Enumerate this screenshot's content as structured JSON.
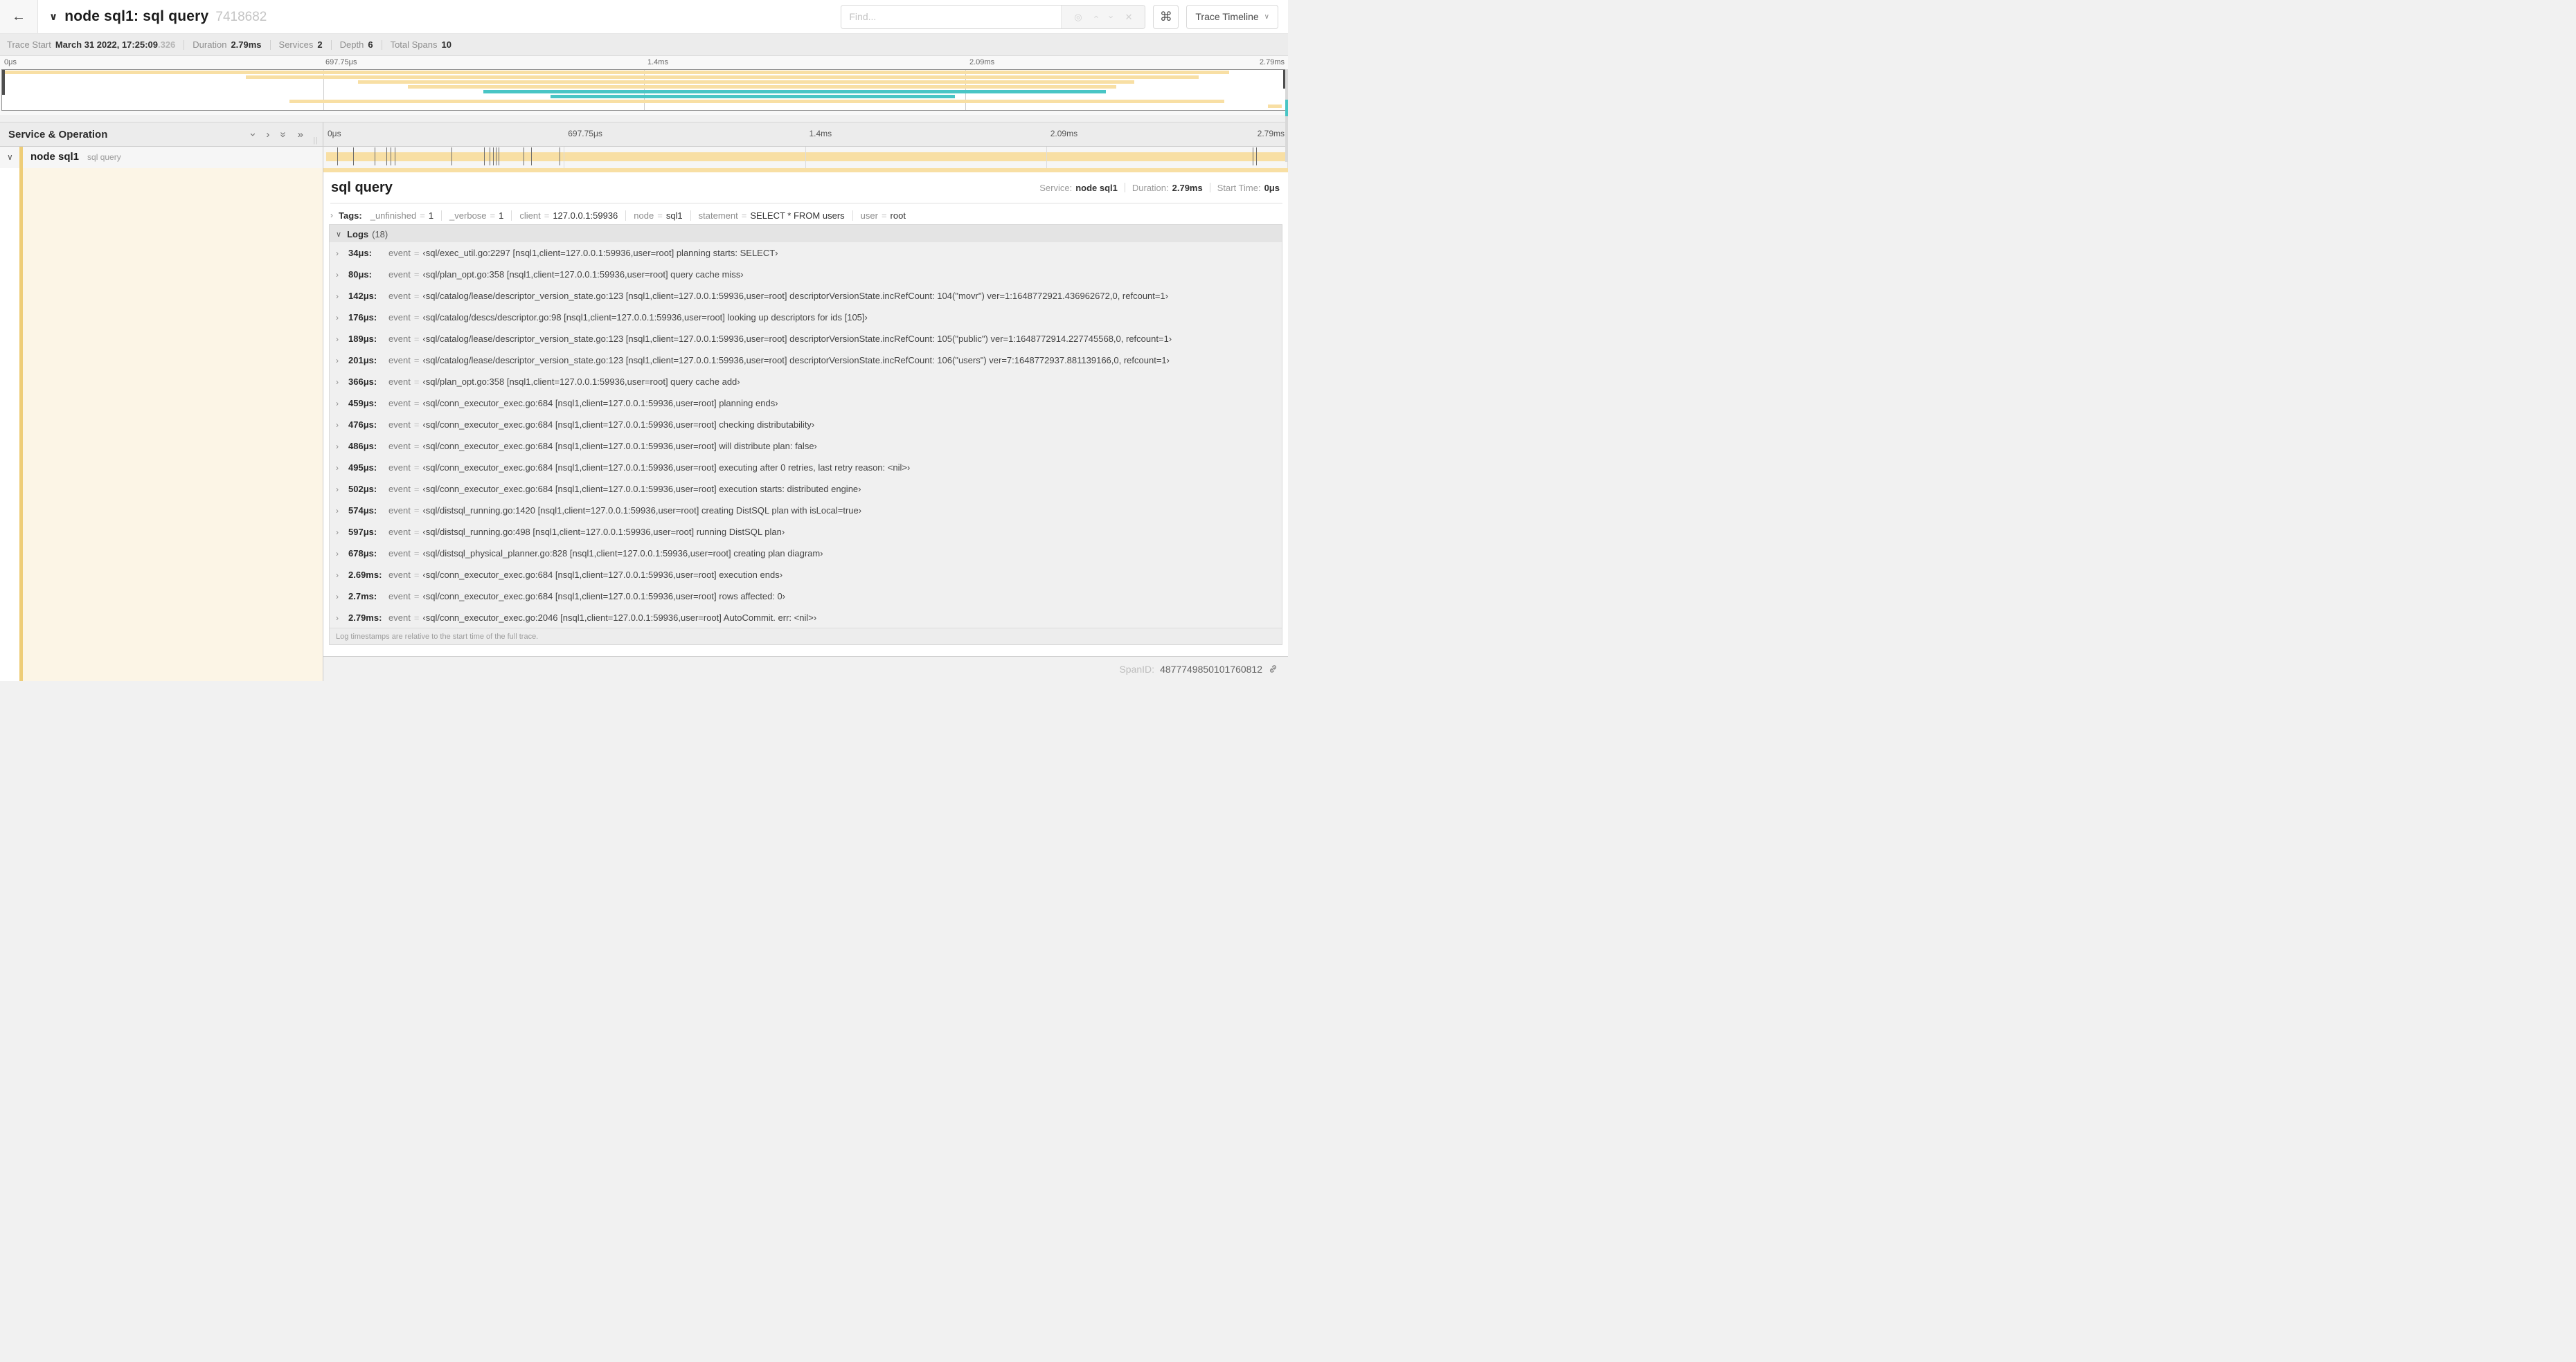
{
  "icons": {
    "back": "←",
    "title_chevron": "∨",
    "command": "⌘",
    "caret_down": "∨",
    "locate": "◎",
    "prev_match": "›",
    "next_match": "›",
    "clear": "✕",
    "collapse_one": "›",
    "expand_one": "›",
    "collapse_all": "»",
    "expand_all": "»",
    "resizer": "||",
    "row_chevron": "∨",
    "item_chevron": "›"
  },
  "header": {
    "title": "node sql1: sql query",
    "trace_id": "7418682",
    "find_placeholder": "Find...",
    "view_select_label": "Trace Timeline"
  },
  "info_bar": {
    "items": [
      {
        "label": "Trace Start",
        "value": "March 31 2022, 17:25:09",
        "suffix": ".326"
      },
      {
        "label": "Duration",
        "value": "2.79ms"
      },
      {
        "label": "Services",
        "value": "2"
      },
      {
        "label": "Depth",
        "value": "6"
      },
      {
        "label": "Total Spans",
        "value": "10"
      }
    ]
  },
  "left_header": {
    "title": "Service & Operation"
  },
  "span_row": {
    "service": "node sql1",
    "operation": "sql query"
  },
  "timeline": {
    "ruler_ticks": [
      "0μs",
      "697.75μs",
      "1.4ms",
      "2.09ms",
      "2.79ms"
    ],
    "total_us": 2790,
    "log_marks_us": [
      34,
      80,
      142,
      176,
      189,
      201,
      366,
      459,
      476,
      486,
      495,
      502,
      574,
      597,
      678,
      2690,
      2700,
      2790
    ],
    "minimap_spans": [
      {
        "row": 0,
        "start": 0.0,
        "end": 0.956,
        "color": "tan"
      },
      {
        "row": 1,
        "start": 0.19,
        "end": 0.932,
        "color": "tan"
      },
      {
        "row": 2,
        "start": 0.277,
        "end": 0.882,
        "color": "tan"
      },
      {
        "row": 3,
        "start": 0.316,
        "end": 0.868,
        "color": "tan"
      },
      {
        "row": 4,
        "start": 0.375,
        "end": 0.86,
        "color": "teal"
      },
      {
        "row": 5,
        "start": 0.427,
        "end": 0.742,
        "color": "teal"
      },
      {
        "row": 6,
        "start": 0.224,
        "end": 0.952,
        "color": "tan"
      },
      {
        "row": 7,
        "start": 0.986,
        "end": 0.997,
        "color": "tan"
      }
    ]
  },
  "colors": {
    "tan": "#f8dfa4",
    "teal": "#49c5c5",
    "accent": "#eecd78",
    "cream": "#fcf5e6"
  },
  "detail": {
    "title": "sql query",
    "meta": [
      {
        "label": "Service:",
        "value": "node sql1"
      },
      {
        "label": "Duration:",
        "value": "2.79ms"
      },
      {
        "label": "Start Time:",
        "value": "0μs"
      }
    ],
    "tags_label": "Tags:",
    "kv_separator": "=",
    "tags": [
      {
        "key": "_unfinished",
        "value": "1"
      },
      {
        "key": "_verbose",
        "value": "1"
      },
      {
        "key": "client",
        "value": "127.0.0.1:59936"
      },
      {
        "key": "node",
        "value": "sql1"
      },
      {
        "key": "statement",
        "value": "SELECT * FROM users"
      },
      {
        "key": "user",
        "value": "root"
      }
    ],
    "logs_label": "Logs",
    "logs_count": "(18)",
    "log_key": "event",
    "logs": [
      {
        "time": "34μs:",
        "value": "‹sql/exec_util.go:2297 [nsql1,client=127.0.0.1:59936,user=root] planning starts: SELECT›"
      },
      {
        "time": "80μs:",
        "value": "‹sql/plan_opt.go:358 [nsql1,client=127.0.0.1:59936,user=root] query cache miss›"
      },
      {
        "time": "142μs:",
        "value": "‹sql/catalog/lease/descriptor_version_state.go:123 [nsql1,client=127.0.0.1:59936,user=root] descriptorVersionState.incRefCount: 104(\"movr\") ver=1:1648772921.436962672,0, refcount=1›"
      },
      {
        "time": "176μs:",
        "value": "‹sql/catalog/descs/descriptor.go:98 [nsql1,client=127.0.0.1:59936,user=root] looking up descriptors for ids [105]›"
      },
      {
        "time": "189μs:",
        "value": "‹sql/catalog/lease/descriptor_version_state.go:123 [nsql1,client=127.0.0.1:59936,user=root] descriptorVersionState.incRefCount: 105(\"public\") ver=1:1648772914.227745568,0, refcount=1›"
      },
      {
        "time": "201μs:",
        "value": "‹sql/catalog/lease/descriptor_version_state.go:123 [nsql1,client=127.0.0.1:59936,user=root] descriptorVersionState.incRefCount: 106(\"users\") ver=7:1648772937.881139166,0, refcount=1›"
      },
      {
        "time": "366μs:",
        "value": "‹sql/plan_opt.go:358 [nsql1,client=127.0.0.1:59936,user=root] query cache add›"
      },
      {
        "time": "459μs:",
        "value": "‹sql/conn_executor_exec.go:684 [nsql1,client=127.0.0.1:59936,user=root] planning ends›"
      },
      {
        "time": "476μs:",
        "value": "‹sql/conn_executor_exec.go:684 [nsql1,client=127.0.0.1:59936,user=root] checking distributability›"
      },
      {
        "time": "486μs:",
        "value": "‹sql/conn_executor_exec.go:684 [nsql1,client=127.0.0.1:59936,user=root] will distribute plan: false›"
      },
      {
        "time": "495μs:",
        "value": "‹sql/conn_executor_exec.go:684 [nsql1,client=127.0.0.1:59936,user=root] executing after 0 retries, last retry reason: <nil>›"
      },
      {
        "time": "502μs:",
        "value": "‹sql/conn_executor_exec.go:684 [nsql1,client=127.0.0.1:59936,user=root] execution starts: distributed engine›"
      },
      {
        "time": "574μs:",
        "value": "‹sql/distsql_running.go:1420 [nsql1,client=127.0.0.1:59936,user=root] creating DistSQL plan with isLocal=true›"
      },
      {
        "time": "597μs:",
        "value": "‹sql/distsql_running.go:498 [nsql1,client=127.0.0.1:59936,user=root] running DistSQL plan›"
      },
      {
        "time": "678μs:",
        "value": "‹sql/distsql_physical_planner.go:828 [nsql1,client=127.0.0.1:59936,user=root] creating plan diagram›"
      },
      {
        "time": "2.69ms:",
        "value": "‹sql/conn_executor_exec.go:684 [nsql1,client=127.0.0.1:59936,user=root] execution ends›"
      },
      {
        "time": "2.7ms:",
        "value": "‹sql/conn_executor_exec.go:684 [nsql1,client=127.0.0.1:59936,user=root] rows affected: 0›"
      },
      {
        "time": "2.79ms:",
        "value": "‹sql/conn_executor_exec.go:2046 [nsql1,client=127.0.0.1:59936,user=root] AutoCommit. err: <nil>›"
      }
    ],
    "footnote": "Log timestamps are relative to the start time of the full trace.",
    "span_id_label": "SpanID:",
    "span_id": "4877749850101760812"
  }
}
